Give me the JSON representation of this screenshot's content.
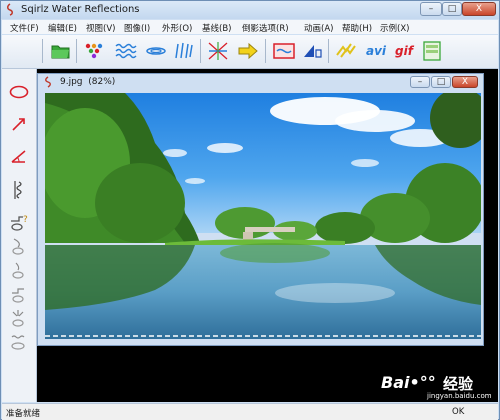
{
  "window": {
    "title": "Sqirlz Water Reflections",
    "min_glyph": "–",
    "max_glyph": "□",
    "close_glyph": "X"
  },
  "menu": [
    {
      "label": "文件(F)"
    },
    {
      "label": "编辑(E)"
    },
    {
      "label": "视图(V)"
    },
    {
      "label": "图像(I)"
    },
    {
      "label": "外形(O)"
    },
    {
      "label": "基线(B)"
    },
    {
      "label": "倒影选项(R)"
    },
    {
      "label": "动画(A)"
    },
    {
      "label": "帮助(H)"
    },
    {
      "label": "示例(X)"
    }
  ],
  "toolbar": {
    "avi_label": "avi",
    "gif_label": "gif"
  },
  "child_window": {
    "title": "9.jpg",
    "zoom": "(82%)"
  },
  "status": {
    "left": "准备就绪",
    "right": "OK"
  },
  "watermark": {
    "brand": "Bai•°°",
    "cn": "经验",
    "url": "jingyan.baidu.com"
  },
  "colors": {
    "title_bg": "#c3d8ef",
    "accent_red": "#d9202a",
    "workspace": "#000000"
  }
}
